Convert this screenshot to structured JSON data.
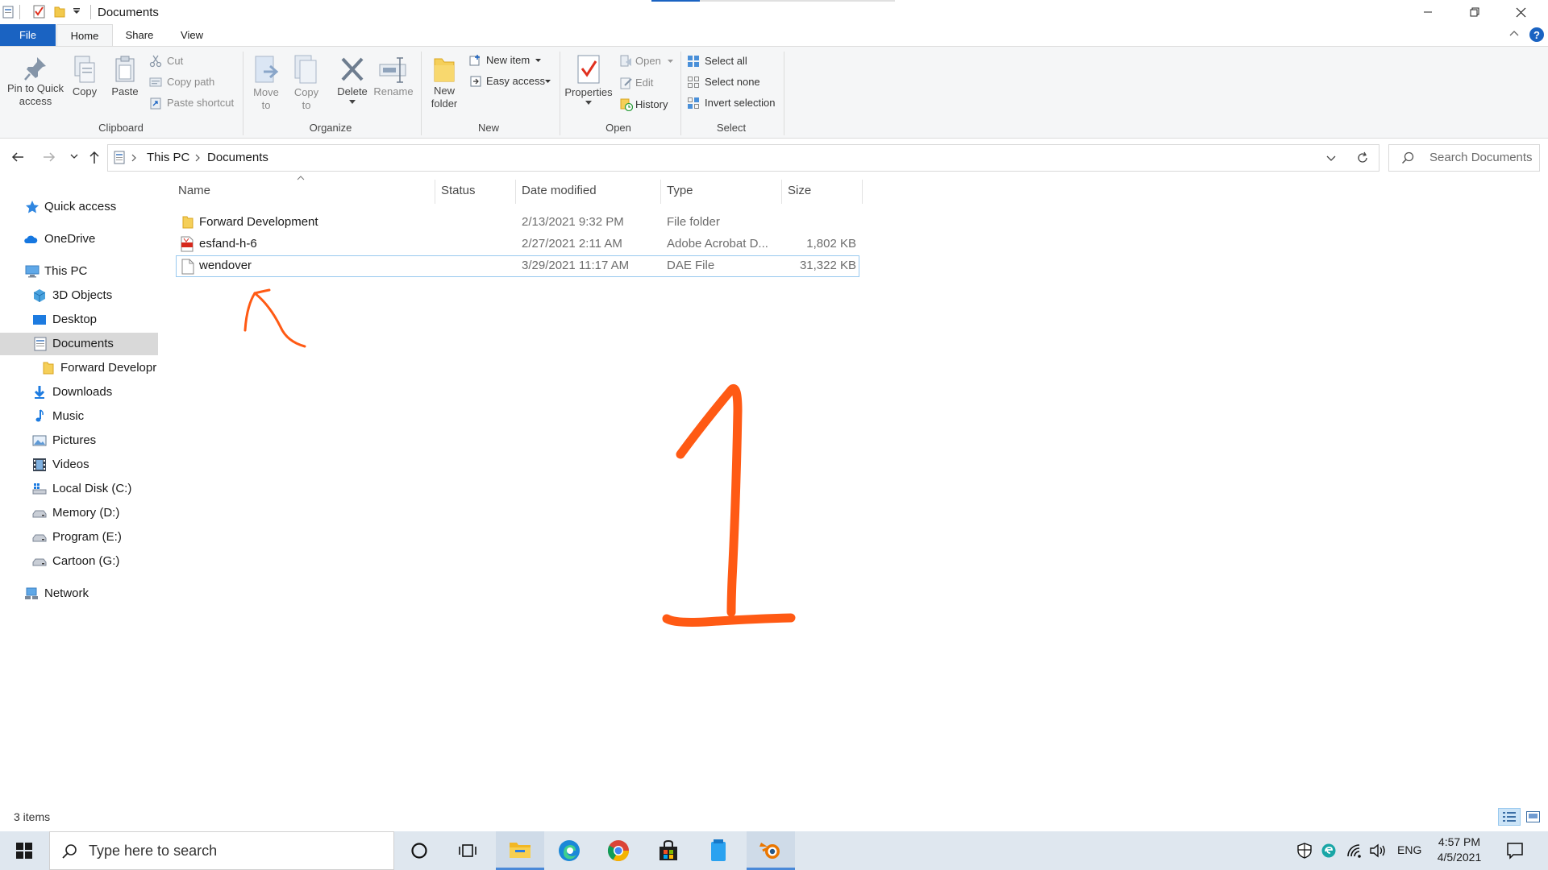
{
  "window": {
    "title": "Documents"
  },
  "tabs": [
    "File",
    "Home",
    "Share",
    "View"
  ],
  "ribbon": {
    "clipboard": {
      "group": "Clipboard",
      "pin": "Pin to Quick access",
      "pin_l1": "Pin to Quick",
      "pin_l2": "access",
      "copy": "Copy",
      "paste": "Paste",
      "cut": "Cut",
      "copy_path": "Copy path",
      "paste_shortcut": "Paste shortcut"
    },
    "organize": {
      "group": "Organize",
      "move_l1": "Move",
      "move_l2": "to",
      "copy_l1": "Copy",
      "copy_l2": "to",
      "delete": "Delete",
      "rename": "Rename"
    },
    "new": {
      "group": "New",
      "new_folder_l1": "New",
      "new_folder_l2": "folder",
      "new_item": "New item",
      "easy_access": "Easy access"
    },
    "open": {
      "group": "Open",
      "properties": "Properties",
      "open": "Open",
      "edit": "Edit",
      "history": "History"
    },
    "select": {
      "group": "Select",
      "select_all": "Select all",
      "select_none": "Select none",
      "invert": "Invert selection"
    }
  },
  "address": {
    "crumbs": [
      "This PC",
      "Documents"
    ],
    "search_placeholder": "Search Documents"
  },
  "nav": {
    "quick_access": "Quick access",
    "onedrive": "OneDrive",
    "this_pc": "This PC",
    "objects3d": "3D Objects",
    "desktop": "Desktop",
    "documents": "Documents",
    "forward_dev": "Forward Developr",
    "downloads": "Downloads",
    "music": "Music",
    "pictures": "Pictures",
    "videos": "Videos",
    "local_c": "Local Disk (C:)",
    "memory_d": "Memory (D:)",
    "program_e": "Program (E:)",
    "cartoon_g": "Cartoon (G:)",
    "network": "Network"
  },
  "columns": {
    "name": "Name",
    "status": "Status",
    "date": "Date modified",
    "type": "Type",
    "size": "Size"
  },
  "files": [
    {
      "name": "Forward Development",
      "date": "2/13/2021 9:32 PM",
      "type": "File folder",
      "size": "",
      "icon": "folder-icon"
    },
    {
      "name": "esfand-h-6",
      "date": "2/27/2021 2:11 AM",
      "type": "Adobe Acrobat D...",
      "size": "1,802 KB",
      "icon": "pdf-icon"
    },
    {
      "name": "wendover",
      "date": "3/29/2021 11:17 AM",
      "type": "DAE File",
      "size": "31,322 KB",
      "icon": "file-icon"
    }
  ],
  "status": {
    "count": "3 items"
  },
  "taskbar": {
    "search_placeholder": "Type here to search",
    "lang": "ENG",
    "time": "4:57 PM",
    "date": "4/5/2021"
  },
  "colors": {
    "accent": "#1a63c2",
    "annotation": "#ff5a14",
    "selection": "#d9d9d9"
  }
}
